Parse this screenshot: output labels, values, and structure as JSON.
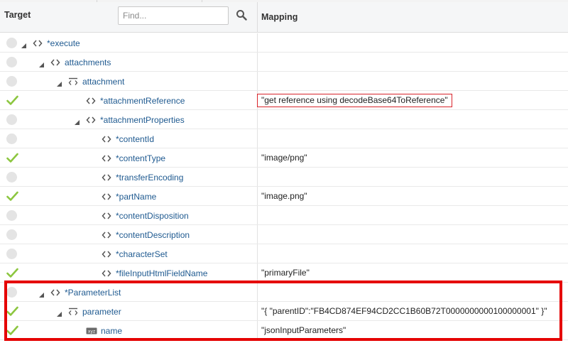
{
  "header": {
    "target_label": "Target",
    "mapping_label": "Mapping",
    "search_placeholder": "Find..."
  },
  "colors": {
    "node_text": "#1f5a90",
    "check": "#8cc63f",
    "highlight": "#e50000"
  },
  "rows": [
    {
      "label": "*execute",
      "depth": 0,
      "expander": "expanded",
      "icon": "element-icon",
      "status": "empty",
      "mapping": ""
    },
    {
      "label": "attachments",
      "depth": 1,
      "expander": "expanded",
      "icon": "element-icon",
      "status": "empty",
      "mapping": ""
    },
    {
      "label": "attachment",
      "depth": 2,
      "expander": "expanded",
      "icon": "repeating-element-icon",
      "status": "empty",
      "mapping": ""
    },
    {
      "label": "*attachmentReference",
      "depth": 3,
      "expander": "none",
      "icon": "element-icon",
      "status": "mapped",
      "mapping": "\"get reference using decodeBase64ToReference\"",
      "mapping_boxed": true
    },
    {
      "label": "*attachmentProperties",
      "depth": 3,
      "expander": "expanded",
      "icon": "element-icon",
      "status": "empty",
      "mapping": ""
    },
    {
      "label": "*contentId",
      "depth": 4,
      "expander": "none",
      "icon": "element-icon",
      "status": "empty",
      "mapping": ""
    },
    {
      "label": "*contentType",
      "depth": 4,
      "expander": "none",
      "icon": "element-icon",
      "status": "mapped",
      "mapping": "\"image/png\""
    },
    {
      "label": "*transferEncoding",
      "depth": 4,
      "expander": "none",
      "icon": "element-icon",
      "status": "empty",
      "mapping": ""
    },
    {
      "label": "*partName",
      "depth": 4,
      "expander": "none",
      "icon": "element-icon",
      "status": "mapped",
      "mapping": "\"image.png\""
    },
    {
      "label": "*contentDisposition",
      "depth": 4,
      "expander": "none",
      "icon": "element-icon",
      "status": "empty",
      "mapping": ""
    },
    {
      "label": "*contentDescription",
      "depth": 4,
      "expander": "none",
      "icon": "element-icon",
      "status": "empty",
      "mapping": ""
    },
    {
      "label": "*characterSet",
      "depth": 4,
      "expander": "none",
      "icon": "element-icon",
      "status": "empty",
      "mapping": ""
    },
    {
      "label": "*fileInputHtmlFieldName",
      "depth": 4,
      "expander": "none",
      "icon": "element-icon",
      "status": "mapped",
      "mapping": "\"primaryFile\""
    },
    {
      "label": "*ParameterList",
      "depth": 1,
      "expander": "expanded",
      "icon": "element-icon",
      "status": "empty",
      "mapping": ""
    },
    {
      "label": "parameter",
      "depth": 2,
      "expander": "expanded",
      "icon": "repeating-element-icon",
      "status": "mapped",
      "mapping": "\"{ \"parentID\":\"FB4CD874EF94CD2CC1B60B72T0000000000100000001\" }\""
    },
    {
      "label": "name",
      "depth": 3,
      "expander": "none",
      "icon": "attribute-icon",
      "status": "mapped",
      "mapping": "\"jsonInputParameters\""
    }
  ]
}
